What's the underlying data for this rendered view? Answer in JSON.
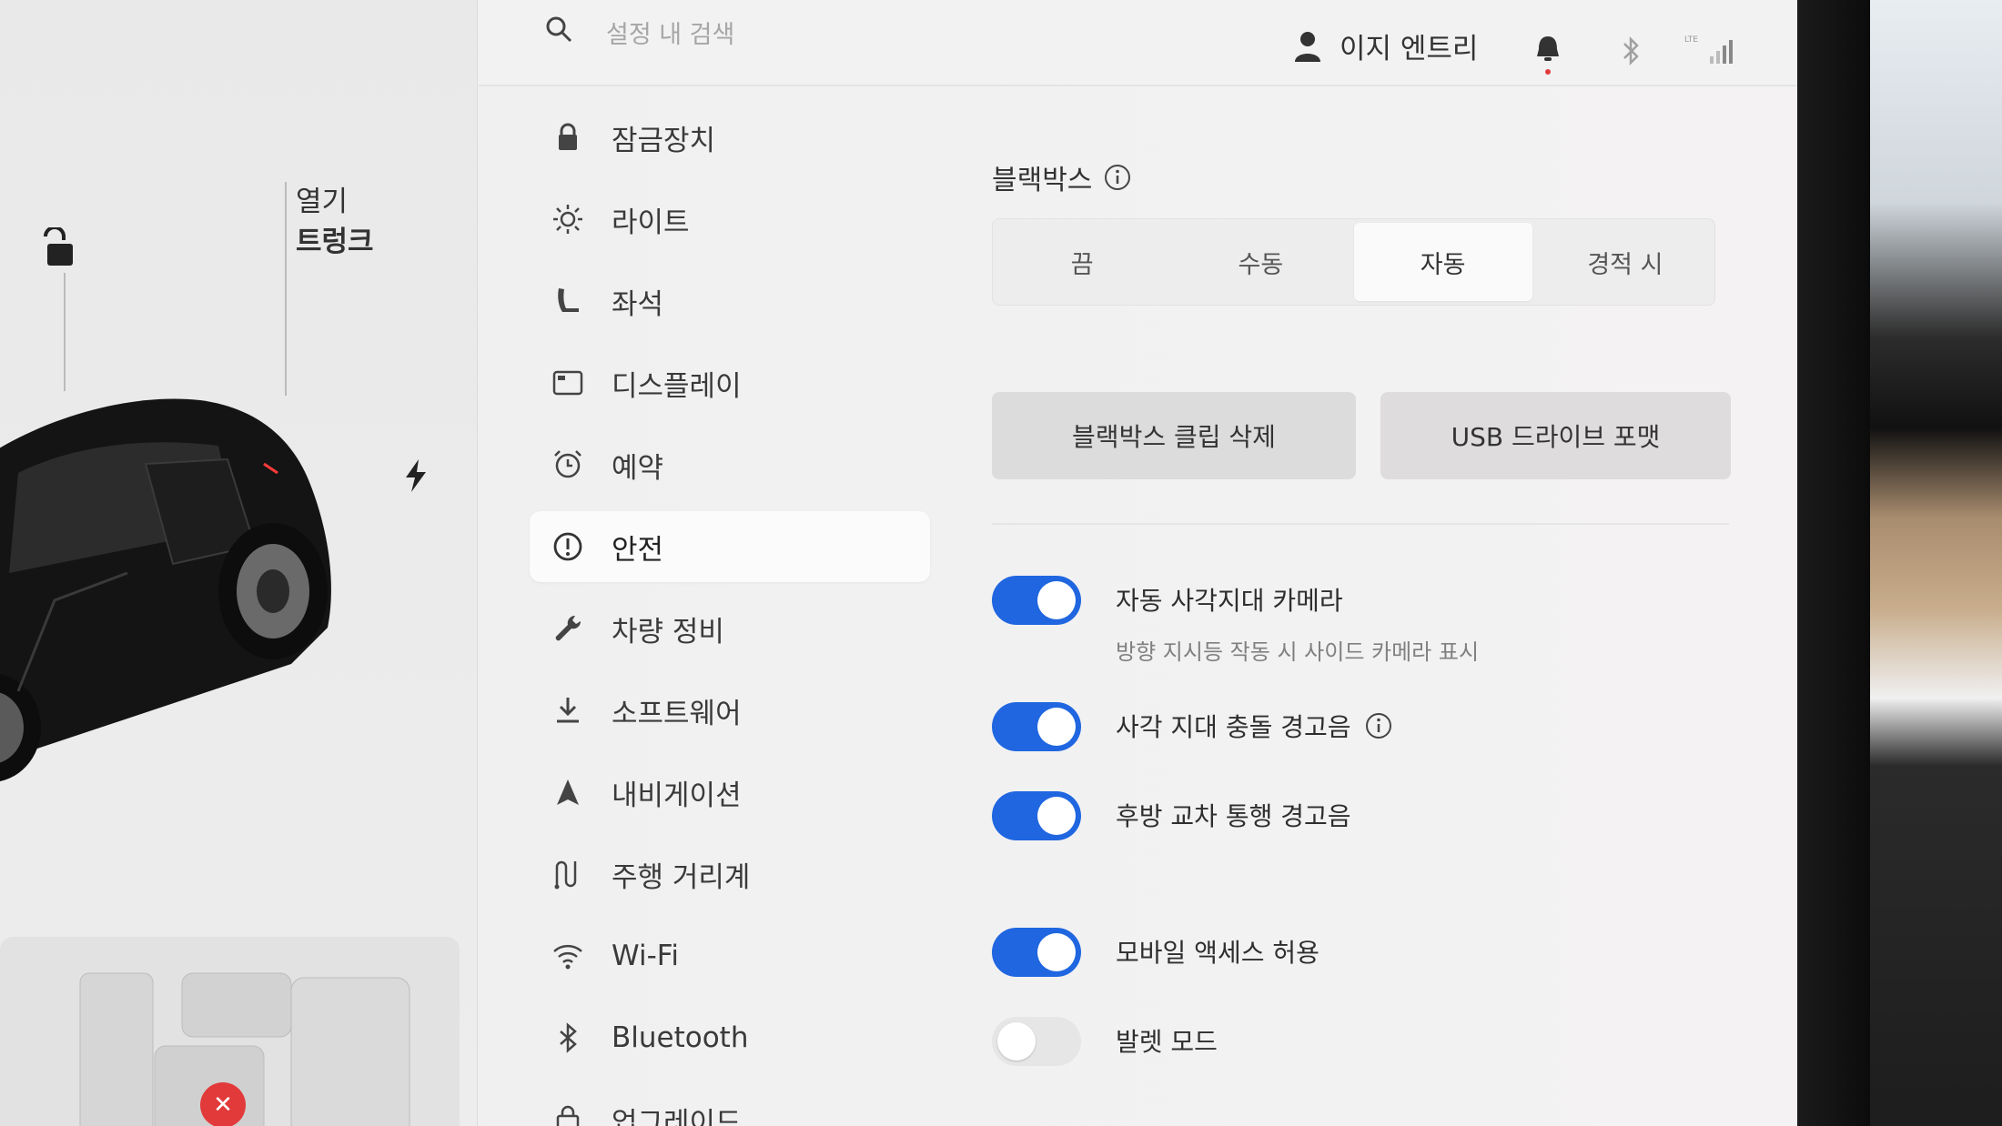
{
  "car_panel": {
    "trunk_label_1": "열기",
    "trunk_label_2": "트렁크"
  },
  "top_bar": {
    "search_placeholder": "설정 내 검색",
    "profile_name": "이지 엔트리",
    "signal_label": "LTE"
  },
  "nav": {
    "items": [
      {
        "label": "잠금장치",
        "icon": "lock-icon"
      },
      {
        "label": "라이트",
        "icon": "light-icon"
      },
      {
        "label": "좌석",
        "icon": "seat-icon"
      },
      {
        "label": "디스플레이",
        "icon": "display-icon"
      },
      {
        "label": "예약",
        "icon": "alarm-clock-icon"
      },
      {
        "label": "안전",
        "icon": "safety-icon",
        "active": true
      },
      {
        "label": "차량 정비",
        "icon": "wrench-icon"
      },
      {
        "label": "소프트웨어",
        "icon": "download-icon"
      },
      {
        "label": "내비게이션",
        "icon": "navigation-icon"
      },
      {
        "label": "주행 거리계",
        "icon": "trips-icon"
      },
      {
        "label": "Wi-Fi",
        "icon": "wifi-icon"
      },
      {
        "label": "Bluetooth",
        "icon": "bluetooth-icon"
      },
      {
        "label": "업그레이드",
        "icon": "upgrade-icon"
      }
    ]
  },
  "main": {
    "dashcam_title": "블랙박스",
    "dashcam_options": [
      "끔",
      "수동",
      "자동",
      "경적 시"
    ],
    "dashcam_selected": "자동",
    "clip_delete_button": "블랙박스 클립 삭제",
    "usb_format_button": "USB 드라이브 포맷",
    "toggles": [
      {
        "label": "자동 사각지대 카메라",
        "description": "방향 지시등 작동 시 사이드 카메라 표시",
        "on": true
      },
      {
        "label": "사각 지대 충돌 경고음",
        "on": true,
        "info": true
      },
      {
        "label": "후방 교차 통행 경고음",
        "on": true
      },
      {
        "label": "모바일 액세스 허용",
        "on": true
      },
      {
        "label": "발렛 모드",
        "on": false
      }
    ]
  },
  "colors": {
    "accent": "#1f66e0",
    "alert": "#e23a3a"
  }
}
